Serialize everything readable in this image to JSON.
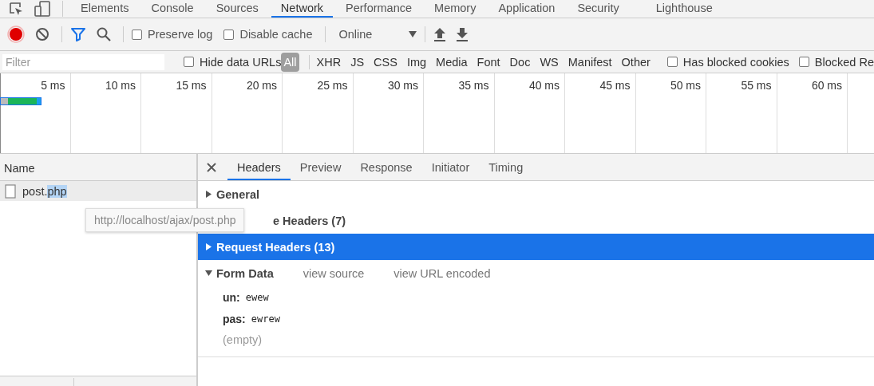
{
  "panel_tabs": [
    {
      "label": "Elements",
      "selected": false
    },
    {
      "label": "Console",
      "selected": false
    },
    {
      "label": "Sources",
      "selected": false
    },
    {
      "label": "Network",
      "selected": true
    },
    {
      "label": "Performance",
      "selected": false
    },
    {
      "label": "Memory",
      "selected": false
    },
    {
      "label": "Application",
      "selected": false
    },
    {
      "label": "Security",
      "selected": false
    },
    {
      "label": "Lighthouse",
      "selected": false
    }
  ],
  "toolbar": {
    "recording": true,
    "preserve_log": {
      "label": "Preserve log",
      "checked": false
    },
    "disable_cache": {
      "label": "Disable cache",
      "checked": false
    },
    "throttling": "Online"
  },
  "filter": {
    "placeholder": "Filter",
    "hide_data_urls": {
      "label": "Hide data URLs",
      "checked": false
    },
    "types": [
      {
        "label": "All",
        "selected": true
      },
      {
        "label": "XHR",
        "selected": false
      },
      {
        "label": "JS",
        "selected": false
      },
      {
        "label": "CSS",
        "selected": false
      },
      {
        "label": "Img",
        "selected": false
      },
      {
        "label": "Media",
        "selected": false
      },
      {
        "label": "Font",
        "selected": false
      },
      {
        "label": "Doc",
        "selected": false
      },
      {
        "label": "WS",
        "selected": false
      },
      {
        "label": "Manifest",
        "selected": false
      },
      {
        "label": "Other",
        "selected": false
      }
    ],
    "has_blocked_cookies": {
      "label": "Has blocked cookies",
      "checked": false
    },
    "blocked_requests": {
      "label": "Blocked Re",
      "checked": false
    }
  },
  "timeline": {
    "ticks": [
      "5 ms",
      "10 ms",
      "15 ms",
      "20 ms",
      "25 ms",
      "30 ms",
      "35 ms",
      "40 ms",
      "45 ms",
      "50 ms",
      "55 ms",
      "60 ms"
    ]
  },
  "requests": {
    "column": "Name",
    "rows": [
      {
        "name": "post.",
        "selected_text": "php",
        "selected": true
      }
    ]
  },
  "tooltip": "http://localhost/ajax/post.php",
  "details": {
    "tabs": [
      {
        "label": "Headers",
        "selected": true
      },
      {
        "label": "Preview",
        "selected": false
      },
      {
        "label": "Response",
        "selected": false
      },
      {
        "label": "Initiator",
        "selected": false
      },
      {
        "label": "Timing",
        "selected": false
      }
    ],
    "sections": [
      {
        "title": "General",
        "expanded": false,
        "selected": false
      },
      {
        "title": "e Headers (7)",
        "expanded": false,
        "selected": false,
        "covered": true
      },
      {
        "title": "Request Headers (13)",
        "expanded": false,
        "selected": true
      },
      {
        "title": "Form Data",
        "expanded": true,
        "selected": false,
        "links": [
          "view source",
          "view URL encoded"
        ],
        "fields": [
          {
            "key": "un:",
            "value": "ewew"
          },
          {
            "key": "pas:",
            "value": "ewrew"
          }
        ],
        "note": "(empty)"
      }
    ]
  }
}
